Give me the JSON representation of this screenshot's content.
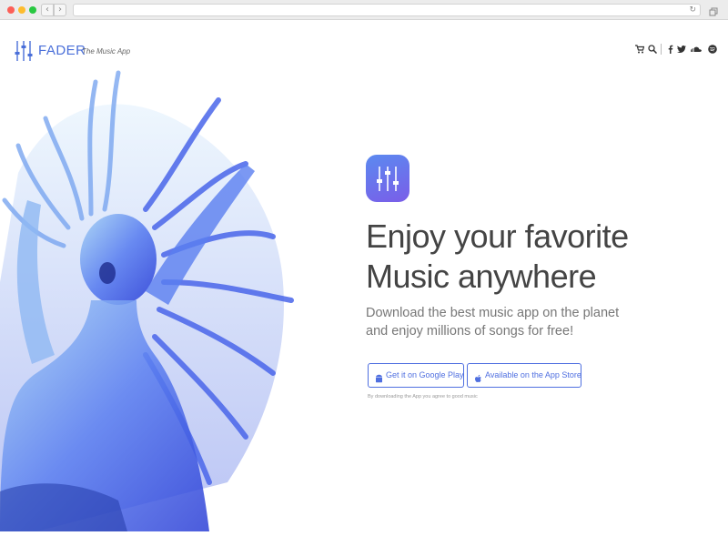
{
  "browser": {
    "back_icon": "chevron-left-icon",
    "forward_icon": "chevron-right-icon",
    "reload_icon": "reload-icon",
    "tabs_icon": "tabs-icon",
    "back_label": "‹",
    "forward_label": "›",
    "reload_label": "↻"
  },
  "header": {
    "brand": "FADER",
    "tagline": "The Music App",
    "icons": [
      "cart-icon",
      "search-icon",
      "facebook-icon",
      "twitter-icon",
      "soundcloud-icon",
      "spotify-icon"
    ]
  },
  "hero": {
    "headline_line1": "Enjoy your favorite",
    "headline_line2": "Music anywhere",
    "subtext": "Download the best music app on the planet and enjoy millions of songs for free!",
    "google_play_label": "Get it on Google Play",
    "app_store_label": "Available on the App Store",
    "disclaimer": "By downloading the App you agree to good music"
  },
  "colors": {
    "accent": "#4f6fe0",
    "icon_gradient_start": "#5b8af0",
    "icon_gradient_end": "#7a5de8"
  }
}
